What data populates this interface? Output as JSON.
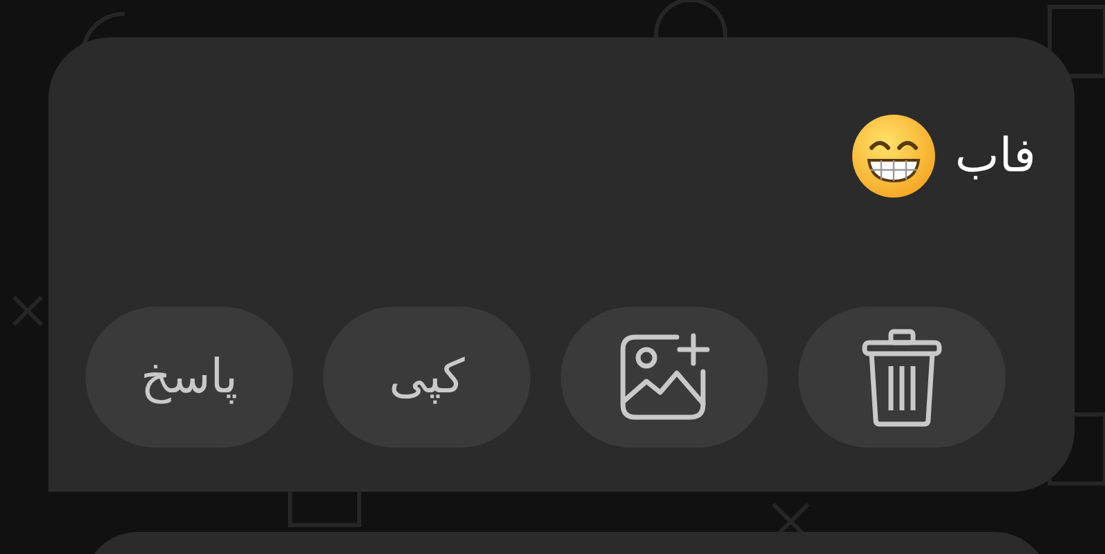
{
  "message": {
    "text": "فاب"
  },
  "actions": [
    {
      "kind": "delete"
    },
    {
      "kind": "image"
    },
    {
      "kind": "text",
      "label": "کپی"
    },
    {
      "kind": "text",
      "label": "پاسخ"
    }
  ]
}
